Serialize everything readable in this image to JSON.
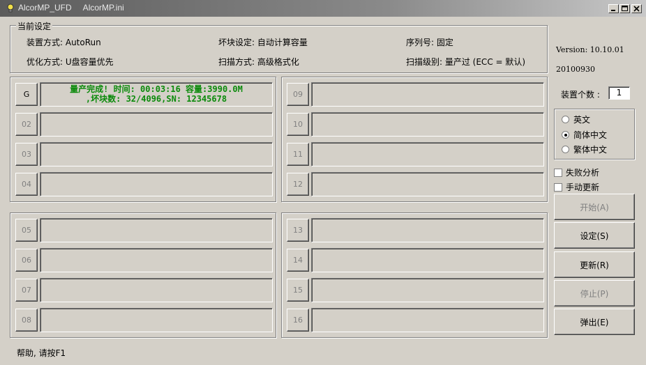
{
  "window": {
    "title": "AlcorMP_UFD     AlcorMP.ini"
  },
  "settings": {
    "group_title": "当前设定",
    "install_mode": "装置方式: AutoRun",
    "bad_block": "坏块设定: 自动计算容量",
    "serial": "序列号: 固定",
    "optimize": "优化方式: U盘容量优先",
    "scan_mode": "扫描方式: 高级格式化",
    "scan_level": "扫描级别: 量产过 (ECC = 默认)"
  },
  "ports": [
    {
      "label": "G",
      "status": "量产完成! 时间: 00:03:16 容量:3990.0M\n,坏块数: 32/4096,SN: 12345678"
    },
    {
      "label": "02",
      "status": ""
    },
    {
      "label": "03",
      "status": ""
    },
    {
      "label": "04",
      "status": ""
    },
    {
      "label": "05",
      "status": ""
    },
    {
      "label": "06",
      "status": ""
    },
    {
      "label": "07",
      "status": ""
    },
    {
      "label": "08",
      "status": ""
    },
    {
      "label": "09",
      "status": ""
    },
    {
      "label": "10",
      "status": ""
    },
    {
      "label": "11",
      "status": ""
    },
    {
      "label": "12",
      "status": ""
    },
    {
      "label": "13",
      "status": ""
    },
    {
      "label": "14",
      "status": ""
    },
    {
      "label": "15",
      "status": ""
    },
    {
      "label": "16",
      "status": ""
    }
  ],
  "info": {
    "version": "Version: 10.10.01",
    "date": "20100930",
    "device_count_label": "装置个数 :",
    "device_count": "1"
  },
  "language": {
    "options": [
      "英文",
      "简体中文",
      "繁体中文"
    ],
    "selected": "简体中文"
  },
  "checks": {
    "fail_analysis": "失败分析",
    "manual_update": "手动更新"
  },
  "buttons": {
    "start": "开始(A)",
    "settings": "设定(S)",
    "refresh": "更新(R)",
    "stop": "停止(P)",
    "eject": "弹出(E)"
  },
  "statusbar": {
    "help": "帮助, 请按F1"
  },
  "colors": {
    "success_text": "#0a8a0a",
    "window_bg": "#d4d0c8"
  }
}
